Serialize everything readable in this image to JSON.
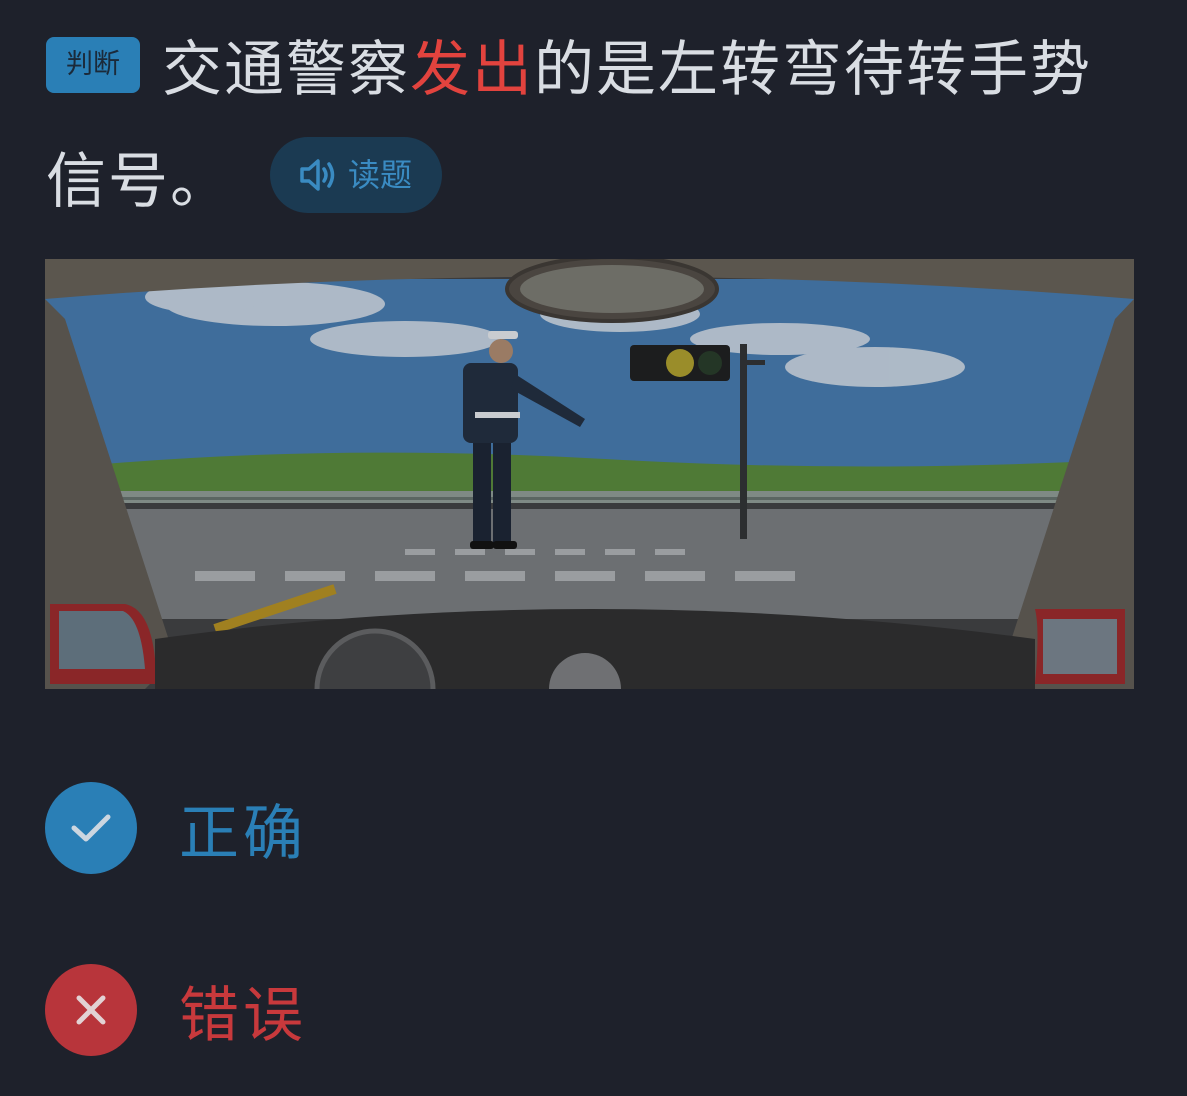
{
  "question": {
    "badge": "判断",
    "text_before": "交通警察",
    "text_highlight": "发出",
    "text_after": "的是左转弯待转手势信号。",
    "read_button_label": "读题",
    "highlight_color": "#e2433e"
  },
  "options": [
    {
      "label": "正确",
      "icon": "checkmark-icon",
      "color": "#2a7fb6"
    },
    {
      "label": "错误",
      "icon": "close-icon",
      "color": "#b8353b"
    }
  ],
  "colors": {
    "background": "#1e212b",
    "accent": "#2a7fb6",
    "error": "#b8353b"
  }
}
